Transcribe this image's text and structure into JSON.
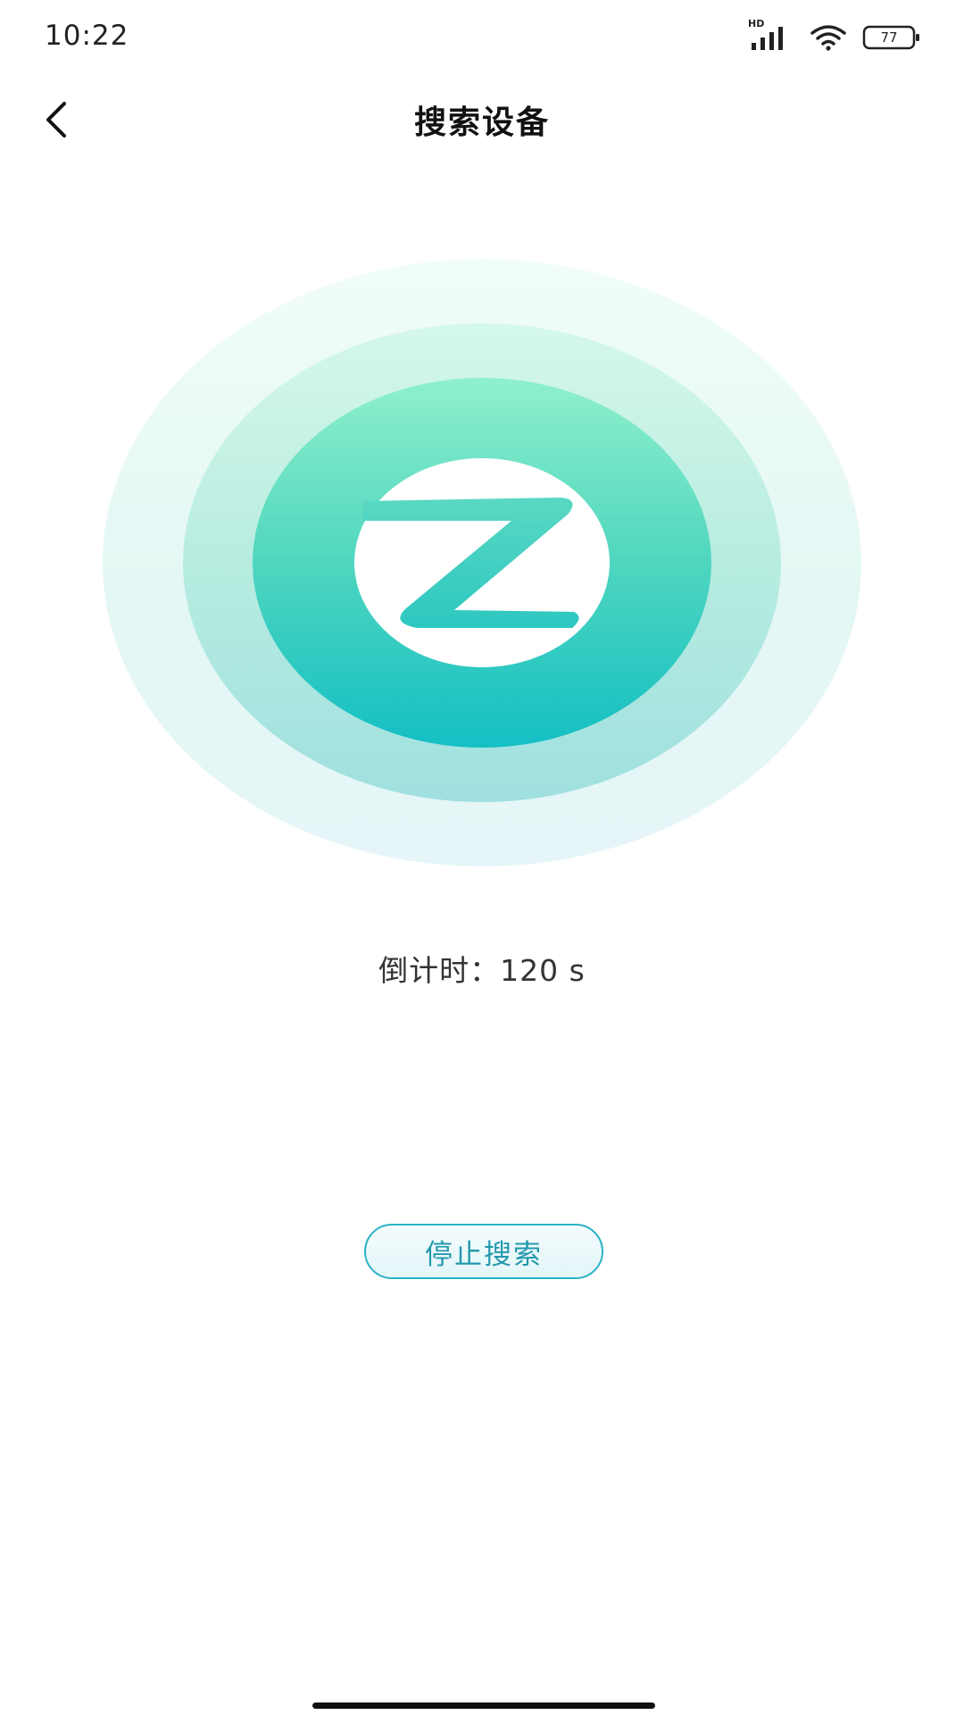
{
  "status_bar": {
    "time": "10:22",
    "network_label": "HD",
    "battery_level": "77",
    "icons": [
      "signal-icon",
      "wifi-icon",
      "battery-icon"
    ]
  },
  "nav": {
    "title": "搜索设备",
    "back_icon": "chevron-left-icon"
  },
  "radar": {
    "logo_icon": "z-logo-icon",
    "colors": {
      "outer": "#e6f7f4",
      "middle": "#b8ece0",
      "inner_top": "#8ff0cc",
      "inner_bottom": "#14bfc4",
      "logo": "#3fcfc0"
    }
  },
  "countdown": {
    "label": "倒计时：",
    "value": "120",
    "unit": "s"
  },
  "actions": {
    "stop_label": "停止搜索",
    "accent_color": "#2bb3c6"
  }
}
